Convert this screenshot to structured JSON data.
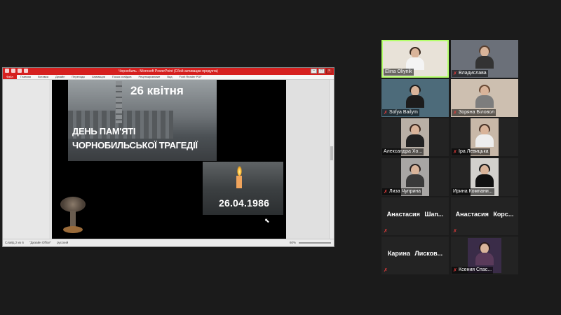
{
  "ppt": {
    "title": "Чорнобиль - Microsoft PowerPoint (Сбой активации продукта)",
    "ribbon_tabs": [
      "Файл",
      "Главная",
      "Вставка",
      "Дизайн",
      "Переходы",
      "Анимация",
      "Показ слайдов",
      "Рецензирование",
      "Вид",
      "Foxit Reader PDF"
    ],
    "slide": {
      "heading_date": "26 квітня",
      "day_line1": "ДЕНЬ ПАМ'ЯТІ",
      "day_line2": "ЧОРНОБИЛЬСЬКОЇ ТРАГЕДІЇ",
      "photo_date": "26.04.1986"
    },
    "status": {
      "slide_counter": "Слайд 2 из 6",
      "theme": "\"Дизайн Office\"",
      "language": "русский",
      "zoom": "60%"
    }
  },
  "participants": [
    {
      "name": "Elina Oliynik",
      "muted": false,
      "video": true,
      "active": true
    },
    {
      "name": "Владислава",
      "muted": true,
      "video": true
    },
    {
      "name": "Sofya Bailym",
      "muted": true,
      "video": true
    },
    {
      "name": "Зоряна Біловол",
      "muted": true,
      "video": true
    },
    {
      "name": "Александра Хо...",
      "muted": false,
      "video": true
    },
    {
      "name": "Іра Левицька",
      "muted": true,
      "video": true
    },
    {
      "name": "Лиза Чуприна",
      "muted": true,
      "video": true
    },
    {
      "name": "Ирина Компани...",
      "muted": false,
      "video": true
    },
    {
      "name": "Анастасия Шап...",
      "muted": true,
      "video": false
    },
    {
      "name": "Анастасия Корс...",
      "muted": true,
      "video": false
    },
    {
      "name": "Карина Лисков...",
      "muted": true,
      "video": false
    },
    {
      "name": "Ксения Спас...",
      "muted": true,
      "video": true
    }
  ],
  "icons": {
    "mic_muted": "mic-muted-icon"
  }
}
